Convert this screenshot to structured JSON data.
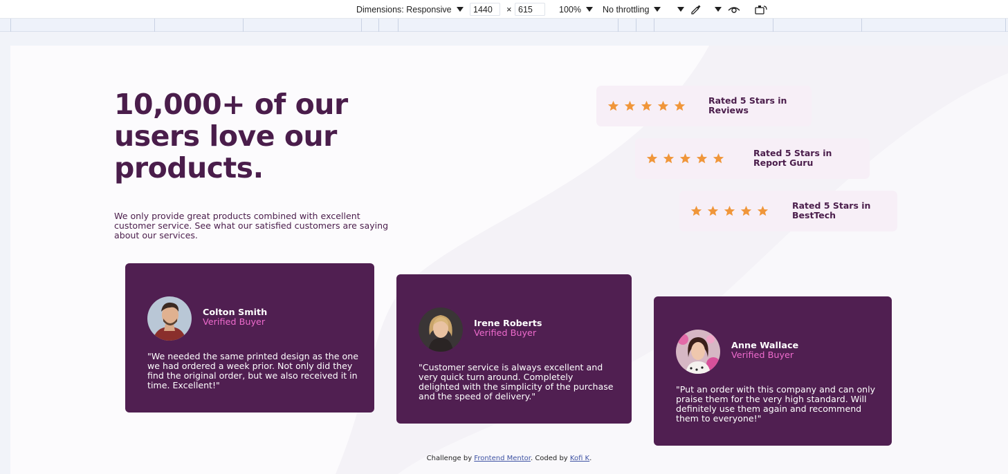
{
  "devtools": {
    "dimensions_label": "Dimensions: Responsive",
    "width_value": "1440",
    "times": "×",
    "height_value": "615",
    "zoom_label": "100%",
    "throttling_label": "No throttling"
  },
  "page": {
    "headline": "10,000+ of our users love our products.",
    "intro": "We only provide great products combined with excellent customer service. See what our satisfied customers are saying about our services.",
    "star_color": "#f0963a",
    "ratings": [
      {
        "stars": 5,
        "label": "Rated 5 Stars in Reviews"
      },
      {
        "stars": 5,
        "label": "Rated 5 Stars in Report Guru"
      },
      {
        "stars": 5,
        "label": "Rated 5 Stars in BestTech"
      }
    ],
    "testimonials": [
      {
        "name": "Colton Smith",
        "role": "Verified Buyer",
        "quote": "\"We needed the same printed design as the one we had ordered a week prior. Not only did they find the original order, but we also received it in time. Excellent!\""
      },
      {
        "name": "Irene Roberts",
        "role": "Verified Buyer",
        "quote": "\"Customer service is always excellent and very quick turn around. Completely delighted with the simplicity of the purchase and the speed of delivery.\""
      },
      {
        "name": "Anne Wallace",
        "role": "Verified Buyer",
        "quote": "\"Put an order with this company and can only praise them for the very high standard. Will definitely use them again and recommend them to everyone!\""
      }
    ],
    "footer": {
      "prefix": "Challenge by ",
      "link1": "Frontend Mentor",
      "middle": ". Coded by ",
      "link2": "Kofi K",
      "suffix": "."
    }
  },
  "colors": {
    "primary": "#4a1d4b",
    "card_bg": "#501f51",
    "accent_pink": "#ee6bcd",
    "rating_bg": "#f7eff7"
  }
}
